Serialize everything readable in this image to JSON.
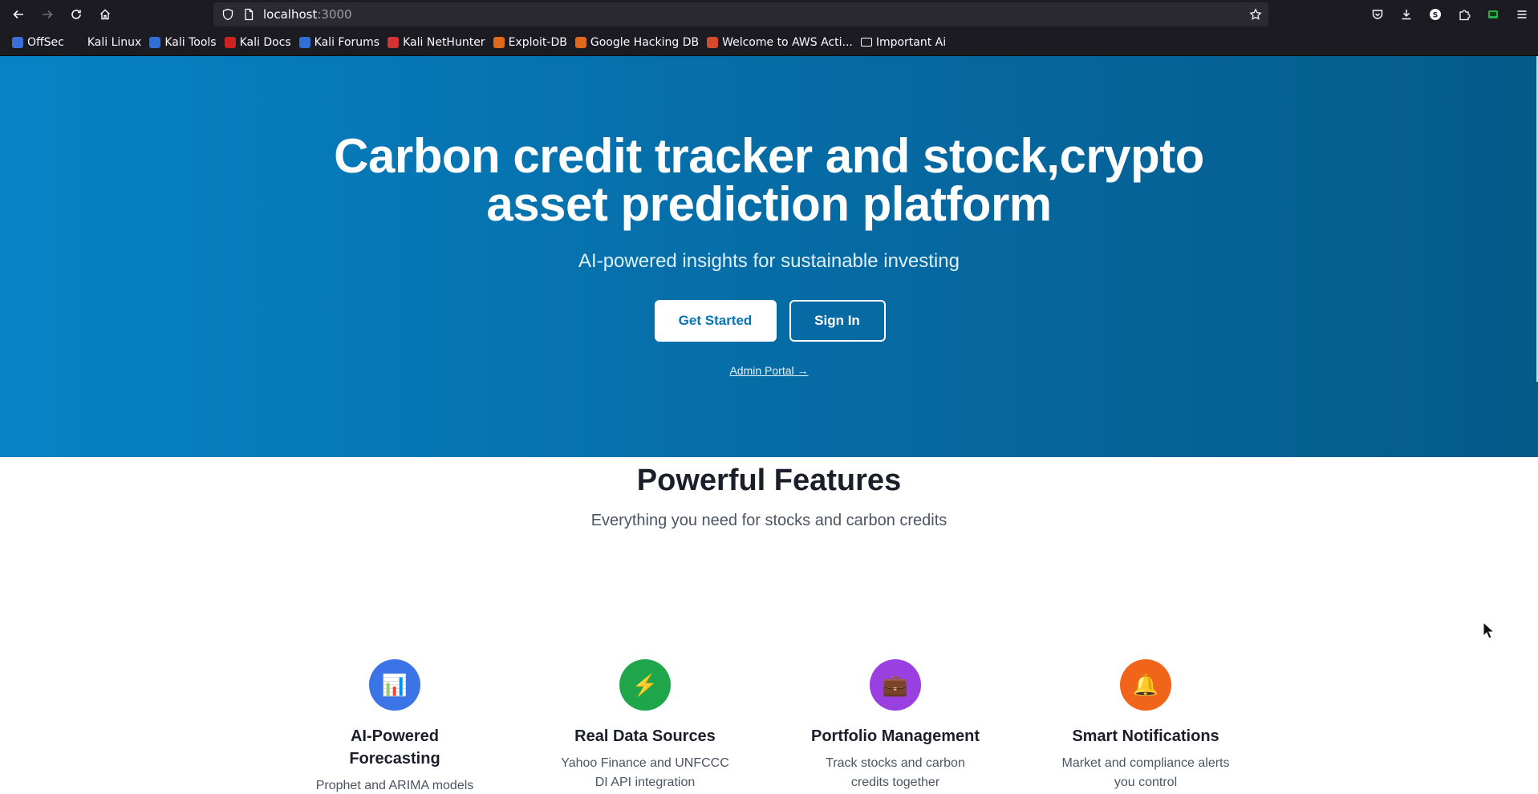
{
  "browser": {
    "url_host": "localhost",
    "url_port": ":3000",
    "bookmarks": [
      {
        "label": "OffSec",
        "color": "#3b6fd8"
      },
      {
        "label": "Kali Linux",
        "color": "#1c1b22"
      },
      {
        "label": "Kali Tools",
        "color": "#2f6fd6"
      },
      {
        "label": "Kali Docs",
        "color": "#cc2222"
      },
      {
        "label": "Kali Forums",
        "color": "#2f6fd6"
      },
      {
        "label": "Kali NetHunter",
        "color": "#d23333"
      },
      {
        "label": "Exploit-DB",
        "color": "#e06a1b"
      },
      {
        "label": "Google Hacking DB",
        "color": "#e06a1b"
      },
      {
        "label": "Welcome to AWS Acti...",
        "color": "#d44a2c"
      },
      {
        "label": "Important Ai",
        "color": "folder"
      }
    ]
  },
  "hero": {
    "title_line1": "Carbon credit tracker and stock,crypto",
    "title_line2": "asset prediction platform",
    "subtitle": "AI-powered insights for sustainable investing",
    "get_started": "Get Started",
    "sign_in": "Sign In",
    "admin_link": "Admin Portal →"
  },
  "features": {
    "title": "Powerful Features",
    "subtitle": "Everything you need for stocks and carbon credits",
    "items": [
      {
        "icon": "chart-icon",
        "glyph": "📊",
        "color": "#3b74e6",
        "title_line1": "AI-Powered",
        "title_line2": "Forecasting",
        "desc_line1": "Prophet and ARIMA models",
        "desc_line2": ""
      },
      {
        "icon": "lightning-icon",
        "glyph": "⚡",
        "color": "#1fa64a",
        "title_line1": "Real Data Sources",
        "title_line2": "",
        "desc_line1": "Yahoo Finance and UNFCCC",
        "desc_line2": "DI API integration"
      },
      {
        "icon": "briefcase-icon",
        "glyph": "💼",
        "color": "#9a3fe0",
        "title_line1": "Portfolio Management",
        "title_line2": "",
        "desc_line1": "Track stocks and carbon",
        "desc_line2": "credits together"
      },
      {
        "icon": "bell-icon",
        "glyph": "🔔",
        "color": "#f0651a",
        "title_line1": "Smart Notifications",
        "title_line2": "",
        "desc_line1": "Market and compliance alerts",
        "desc_line2": "you control"
      }
    ]
  }
}
